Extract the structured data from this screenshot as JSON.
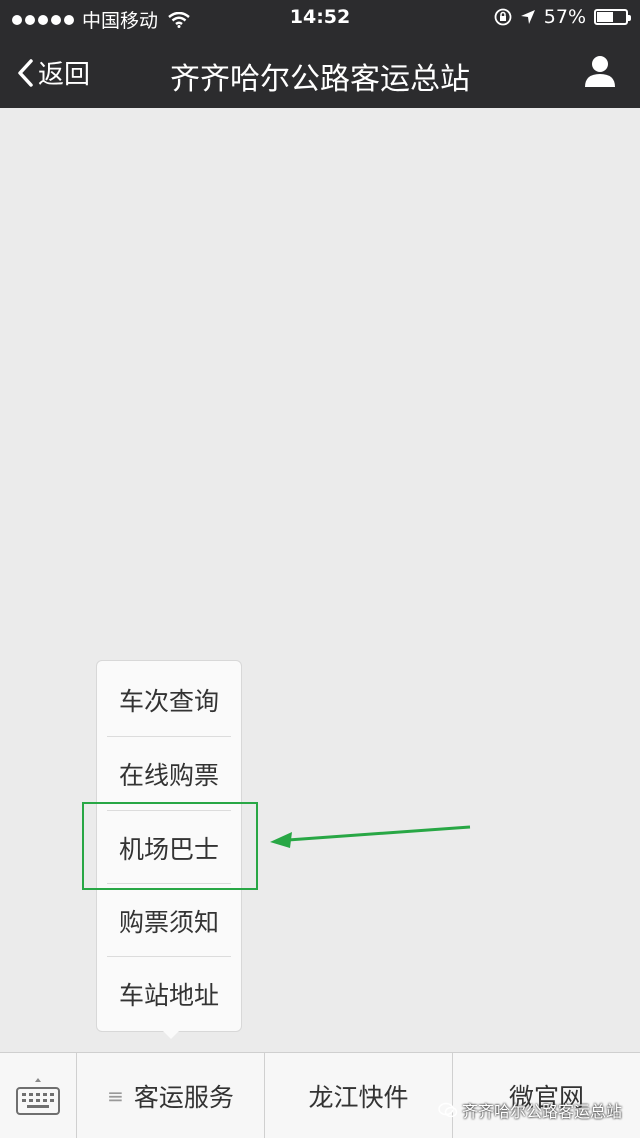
{
  "status_bar": {
    "carrier": "中国移动",
    "time": "14:52",
    "battery": "57%",
    "battery_level": 0.57
  },
  "nav": {
    "back_label": "返回",
    "title": "齐齐哈尔公路客运总站"
  },
  "popup_menu": {
    "items": [
      {
        "label": "车次查询"
      },
      {
        "label": "在线购票"
      },
      {
        "label": "机场巴士",
        "highlighted": true
      },
      {
        "label": "购票须知"
      },
      {
        "label": "车站地址"
      }
    ]
  },
  "bottom_bar": {
    "tabs": [
      {
        "label": "客运服务",
        "has_menu": true
      },
      {
        "label": "龙江快件"
      },
      {
        "label": "微官网"
      }
    ]
  },
  "watermark": "齐齐哈尔公路客运总站",
  "colors": {
    "nav_bg": "#2c2c2e",
    "highlight": "#28a745",
    "background": "#ebebeb"
  }
}
